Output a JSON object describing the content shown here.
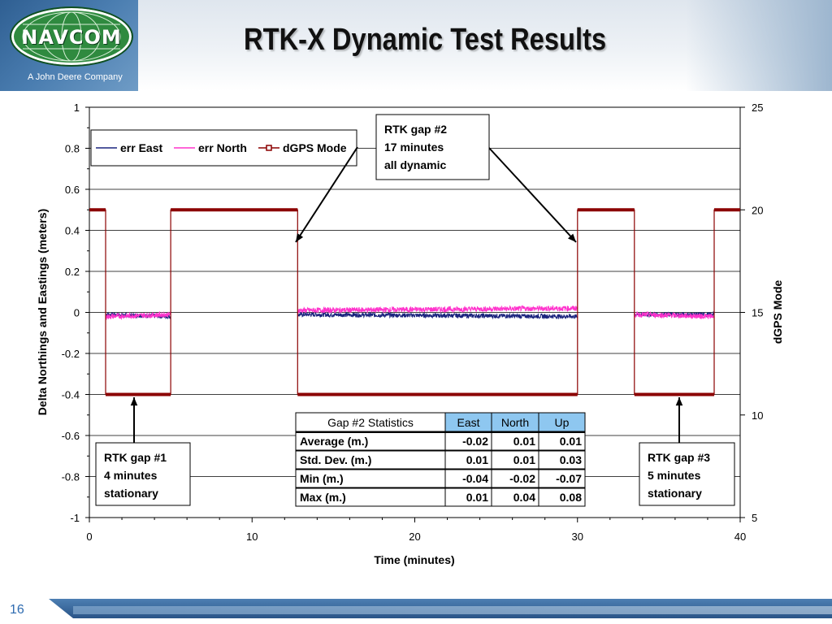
{
  "header": {
    "logo_text": "NAVCOM",
    "tagline": "A John Deere Company",
    "title": "RTK-X Dynamic Test Results"
  },
  "footer": {
    "page_number": "16"
  },
  "colors": {
    "err_east": "#1a237e",
    "err_north": "#ff33cc",
    "dgps_mode": "#8b0000",
    "table_header": "#8ec7f0"
  },
  "chart_data": {
    "type": "line",
    "title": "",
    "xlabel": "Time (minutes)",
    "ylabel": "Delta Northings and Eastings (meters)",
    "y2label": "dGPS Mode",
    "xlim": [
      0,
      40
    ],
    "ylim": [
      -1,
      1
    ],
    "y2lim": [
      5,
      25
    ],
    "xticks": [
      "0",
      "10",
      "20",
      "30",
      "40"
    ],
    "yticks": [
      "1",
      "0.8",
      "0.6",
      "0.4",
      "0.2",
      "0",
      "-0.2",
      "-0.4",
      "-0.6",
      "-0.8",
      "-1"
    ],
    "y2ticks": [
      "25",
      "20",
      "15",
      "10",
      "5"
    ],
    "grid": true,
    "legend_position": "top-left",
    "legend": [
      "err East",
      "err North",
      "dGPS Mode"
    ],
    "series": [
      {
        "name": "err East",
        "segments": [
          {
            "x": [
              1.0,
              5.0
            ],
            "y": [
              -0.01,
              -0.02
            ]
          },
          {
            "x": [
              12.8,
              30.0
            ],
            "y": [
              -0.01,
              -0.02
            ]
          },
          {
            "x": [
              33.5,
              38.4
            ],
            "y": [
              -0.01,
              -0.01
            ]
          }
        ]
      },
      {
        "name": "err North",
        "segments": [
          {
            "x": [
              1.0,
              5.0
            ],
            "y": [
              -0.02,
              -0.01
            ]
          },
          {
            "x": [
              12.8,
              30.0
            ],
            "y": [
              0.01,
              0.02
            ]
          },
          {
            "x": [
              33.5,
              38.4
            ],
            "y": [
              -0.01,
              -0.02
            ]
          }
        ]
      },
      {
        "name": "dGPS Mode",
        "axis": "y2",
        "x": [
          0,
          1.0,
          1.0,
          5.0,
          5.0,
          12.8,
          12.8,
          30.0,
          30.0,
          33.5,
          33.5,
          38.4,
          38.4,
          40
        ],
        "y": [
          20,
          20,
          11,
          11,
          20,
          20,
          11,
          11,
          20,
          20,
          11,
          11,
          20,
          20
        ]
      }
    ],
    "annotations": [
      {
        "id": "gap1",
        "lines": [
          "RTK gap #1",
          "4 minutes",
          "stationary"
        ]
      },
      {
        "id": "gap2",
        "lines": [
          "RTK gap #2",
          "17 minutes",
          "all dynamic"
        ]
      },
      {
        "id": "gap3",
        "lines": [
          "RTK gap #3",
          "5 minutes",
          "stationary"
        ]
      }
    ],
    "stats_table": {
      "columns": [
        "Gap #2 Statistics",
        "East",
        "North",
        "Up"
      ],
      "rows": [
        [
          "Average (m.)",
          "-0.02",
          "0.01",
          "0.01"
        ],
        [
          "Std. Dev. (m.)",
          "0.01",
          "0.01",
          "0.03"
        ],
        [
          "Min (m.)",
          "-0.04",
          "-0.02",
          "-0.07"
        ],
        [
          "Max (m.)",
          "0.01",
          "0.04",
          "0.08"
        ]
      ]
    }
  }
}
